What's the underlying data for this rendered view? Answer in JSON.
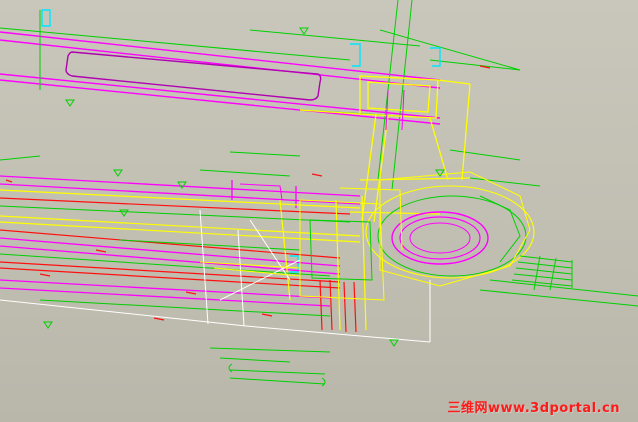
{
  "viewport": {
    "background": "#c4c2b4"
  },
  "colors": {
    "magenta": "#ff00ff",
    "green": "#00d000",
    "yellow": "#ffff00",
    "red": "#ff1010",
    "white": "#ffffff",
    "cyan": "#00e5ff",
    "dark_magenta": "#b000b0"
  },
  "watermark": {
    "text": "三维网www.3dportal.cn",
    "color": "#ff1a1a"
  }
}
